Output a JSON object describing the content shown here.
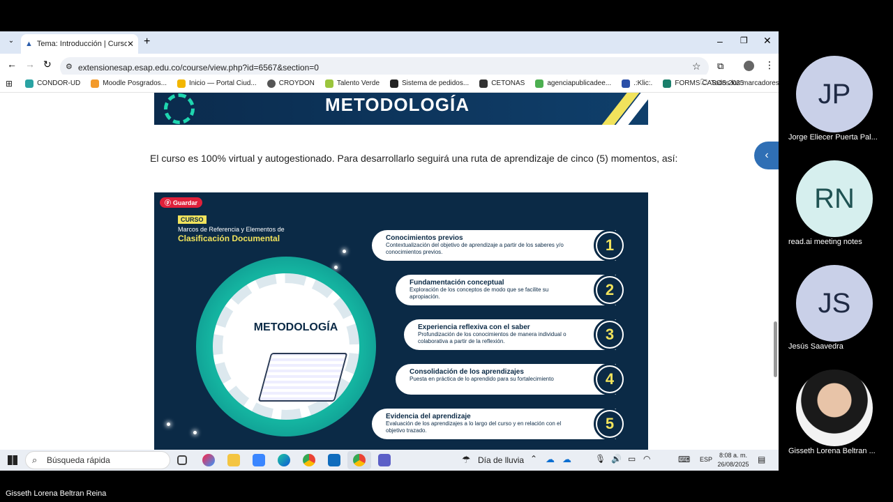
{
  "browser": {
    "tab_title": "Tema: Introducción | Curso: Ma",
    "url": "extensionesap.esap.edu.co/course/view.php?id=6567&section=0",
    "bookmarks": [
      {
        "label": "CONDOR-UD",
        "color": "#2aa3a3"
      },
      {
        "label": "Moodle Posgrados...",
        "color": "#f39a2b"
      },
      {
        "label": "Inicio — Portal Ciud...",
        "color": "#f2b600"
      },
      {
        "label": "CROYDON",
        "color": "#555555"
      },
      {
        "label": "Talento Verde",
        "color": "#9bc53d"
      },
      {
        "label": "Sistema de pedidos...",
        "color": "#222222"
      },
      {
        "label": "CETONAS",
        "color": "#333333"
      },
      {
        "label": "agenciapublicadee...",
        "color": "#4caf50"
      },
      {
        "label": ".:Klic:.",
        "color": "#2a4fa8"
      },
      {
        "label": "FORMS CASOS 2025",
        "color": "#1a7f6b"
      }
    ],
    "all_bookmarks": "Todos los marcadores"
  },
  "page": {
    "banner_title": "METODOLOGÍA",
    "intro": "El curso es 100% virtual y autogestionado. Para desarrollarlo seguirá una ruta de aprendizaje de cinco (5) momentos, así:",
    "infographic": {
      "save_label": "Guardar",
      "curso_tag": "CURSO",
      "course_line1": "Marcos de Referencia y Elementos de",
      "course_line2": "Clasificación Documental",
      "center_label": "METODOLOGÍA",
      "steps": [
        {
          "num": "1",
          "title": "Conocimientos previos",
          "desc": "Contextualización del objetivo de aprendizaje a partir de los saberes y/o conocimientos previos."
        },
        {
          "num": "2",
          "title": "Fundamentación conceptual",
          "desc": "Exploración de los conceptos de modo que se facilite su apropiación."
        },
        {
          "num": "3",
          "title": "Experiencia reflexiva con el saber",
          "desc": "Profundización de los conocimientos de manera individual o colaborativa a partir de la reflexión."
        },
        {
          "num": "4",
          "title": "Consolidación de los aprendizajes",
          "desc": "Puesta en práctica de lo aprendido para su fortalecimiento"
        },
        {
          "num": "5",
          "title": "Evidencia del aprendizaje",
          "desc": "Evaluación de los aprendizajes a lo largo del curso y en relación con el objetivo trazado."
        }
      ]
    }
  },
  "taskbar": {
    "search_placeholder": "Búsqueda rápida",
    "weather": "Día de lluvia",
    "lang": "ESP",
    "time": "8:08 a. m.",
    "date": "26/08/2025"
  },
  "participants": [
    {
      "initials": "JP",
      "name": "Jorge Eliecer Puerta Pal..."
    },
    {
      "initials": "RN",
      "name": "read.ai meeting notes"
    },
    {
      "initials": "JS",
      "name": "Jesús Saavedra"
    },
    {
      "initials": "",
      "name": "Gisseth Lorena Beltran ..."
    }
  ],
  "presenter_name": "Gisseth Lorena Beltran Reina"
}
